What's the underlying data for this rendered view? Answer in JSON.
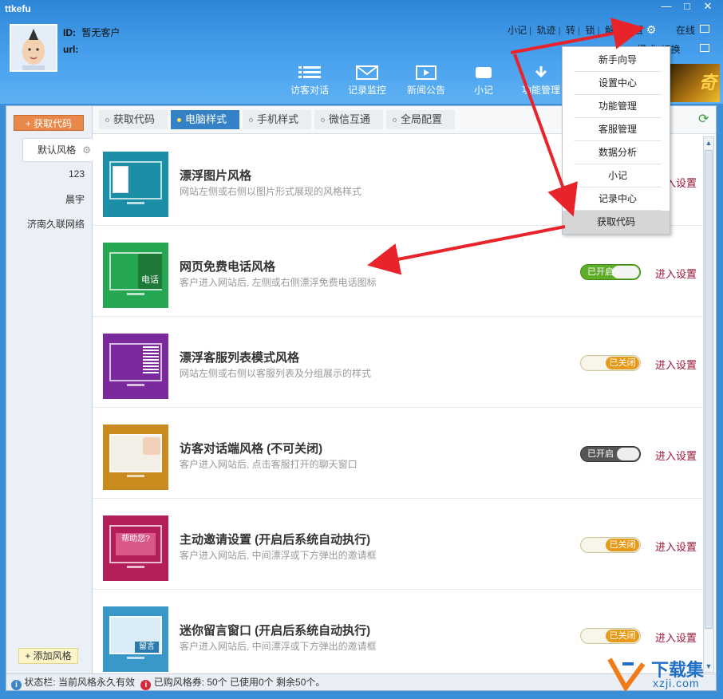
{
  "app": {
    "title": "ttkefu"
  },
  "window": {
    "minimize": "—",
    "maximize": "□",
    "close": "✕"
  },
  "profile": {
    "id_label": "ID:",
    "id_value": "暂无客户",
    "url_label": "url:"
  },
  "toplinks": [
    "小记",
    "轨迹",
    "转",
    "锁",
    "解",
    "设置"
  ],
  "status": {
    "online": "在线",
    "mode_switch": "模式: 切换"
  },
  "nav": [
    {
      "label": "访客对话",
      "icon": "list-icon"
    },
    {
      "label": "记录监控",
      "icon": "mail-icon"
    },
    {
      "label": "新闻公告",
      "icon": "video-icon"
    },
    {
      "label": "小记",
      "icon": "camera-icon"
    },
    {
      "label": "功能管理",
      "icon": "download-icon"
    }
  ],
  "sidebar": {
    "get_code": "+ 获取代码",
    "items": [
      "默认风格",
      "123",
      "晨宇",
      "济南久联网络"
    ],
    "add_style": "+ 添加风格"
  },
  "tabs": [
    "获取代码",
    "电脑样式",
    "手机样式",
    "微信互通",
    "全局配置"
  ],
  "active_tab": "电脑样式",
  "rows": [
    {
      "title": "漂浮图片风格",
      "desc": "网站左侧或右侧以图片形式展现的风格样式",
      "toggle": "",
      "link": "进入设置",
      "color": "#1b8fa6"
    },
    {
      "title": "网页免费电话风格",
      "desc": "客户进入网站后, 左侧或右侧漂浮免费电话图标",
      "toggle": "已开启",
      "link": "进入设置",
      "color": "#25a851",
      "badge": "电话"
    },
    {
      "title": "漂浮客服列表模式风格",
      "desc": "网站左侧或右侧以客服列表及分组展示的样式",
      "toggle": "已关闭",
      "link": "进入设置",
      "color": "#7a2a9c"
    },
    {
      "title": "访客对话端风格 (不可关闭)",
      "desc": "客户进入网站后, 点击客服打开的聊天窗口",
      "toggle": "已开启",
      "link": "进入设置",
      "color": "#c98a1e"
    },
    {
      "title": "主动邀请设置 (开启后系统自动执行)",
      "desc": "客户进入网站后, 中间漂浮或下方弹出的邀请框",
      "toggle": "已关闭",
      "link": "进入设置",
      "color": "#b41e5a",
      "badge": "帮助您?"
    },
    {
      "title": "迷你留言窗口 (开启后系统自动执行)",
      "desc": "客户进入网站后, 中间漂浮或下方弹出的邀请框",
      "toggle": "已关闭",
      "link": "进入设置",
      "color": "#3a98c8",
      "badge": "留言"
    }
  ],
  "statusbar": {
    "text1": "状态栏: 当前风格永久有效",
    "text2": "已购风格券: 50个  已使用0个  剩余50个。"
  },
  "dropdown": [
    "新手向导",
    "设置中心",
    "功能管理",
    "客服管理",
    "数据分析",
    "小记",
    "记录中心",
    "获取代码"
  ],
  "watermark": {
    "main": "下载集",
    "sub": "xzji.com"
  },
  "colors": {
    "accent": "#3581c6",
    "link": "#a0183a",
    "toggle_on": "#5fae2a",
    "toggle_off": "#e69a19"
  }
}
